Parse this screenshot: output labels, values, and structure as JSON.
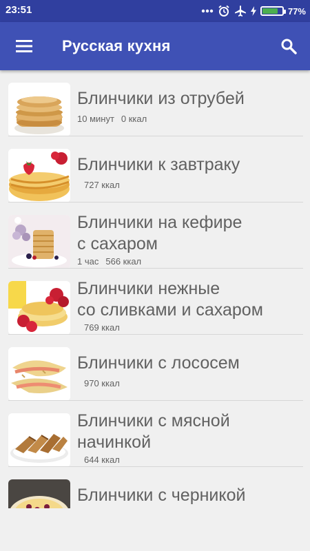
{
  "status_bar": {
    "time": "23:51",
    "battery_percent": "77%",
    "battery_level": 0.77,
    "icons": [
      "more-dots-icon",
      "alarm-icon",
      "airplane-icon",
      "charging-icon",
      "battery-icon"
    ]
  },
  "app_bar": {
    "title": "Русская кухня",
    "menu_icon": "hamburger-menu-icon",
    "search_icon": "search-icon",
    "background_color": "#3f51b5",
    "status_bar_color": "#303f9f"
  },
  "recipes": [
    {
      "title_line1": "Блинчики из отрубей",
      "title_line2": "",
      "time": "10 минут",
      "calories": "0 ккал"
    },
    {
      "title_line1": "Блинчики к завтраку",
      "title_line2": "",
      "time": "",
      "calories": "727 ккал"
    },
    {
      "title_line1": "Блинчики на кефире",
      "title_line2": "с сахаром",
      "time": "1 час",
      "calories": "566 ккал"
    },
    {
      "title_line1": "Блинчики нежные",
      "title_line2": "со сливками и сахаром",
      "time": "",
      "calories": "769 ккал"
    },
    {
      "title_line1": "Блинчики с лососем",
      "title_line2": "",
      "time": "",
      "calories": "970 ккал"
    },
    {
      "title_line1": "Блинчики с мясной",
      "title_line2": "начинкой",
      "time": "",
      "calories": "644 ккал"
    },
    {
      "title_line1": "Блинчики с черникой",
      "title_line2": "",
      "time": "",
      "calories": ""
    }
  ]
}
